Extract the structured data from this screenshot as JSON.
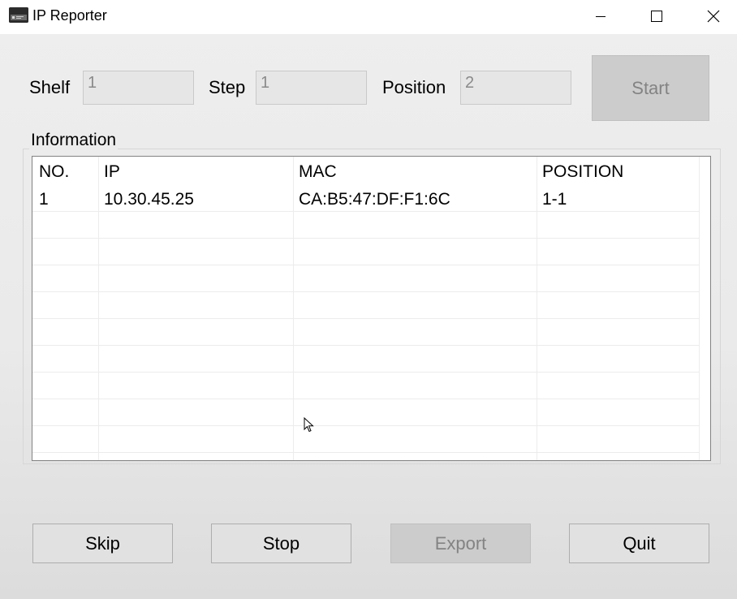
{
  "window": {
    "title": "IP Reporter"
  },
  "inputs": {
    "shelf": {
      "label": "Shelf",
      "value": "1"
    },
    "step": {
      "label": "Step",
      "value": "1"
    },
    "position": {
      "label": "Position",
      "value": "2"
    }
  },
  "start_button": {
    "label": "Start",
    "enabled": false
  },
  "information": {
    "title": "Information",
    "columns": [
      "NO.",
      "IP",
      "MAC",
      "POSITION"
    ],
    "rows": [
      {
        "no": "1",
        "ip": "10.30.45.25",
        "mac": "CA:B5:47:DF:F1:6C",
        "position": "1-1"
      }
    ]
  },
  "buttons": {
    "skip": {
      "label": "Skip",
      "enabled": true
    },
    "stop": {
      "label": "Stop",
      "enabled": true
    },
    "export": {
      "label": "Export",
      "enabled": false
    },
    "quit": {
      "label": "Quit",
      "enabled": true
    }
  },
  "icons": {
    "app": "ip-reporter-app-icon",
    "minimize": "minimize-icon",
    "maximize": "maximize-icon",
    "close": "close-icon",
    "cursor": "mouse-pointer-icon"
  }
}
